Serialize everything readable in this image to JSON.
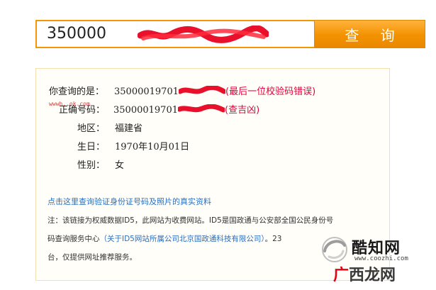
{
  "search": {
    "input_value": "350000",
    "button_label": "查 询"
  },
  "result": {
    "queried": {
      "label": "你查询的是：",
      "value": "35000019701",
      "note": "(最后一位校验码错误)"
    },
    "correct": {
      "label": "正确号码：",
      "value": "35000019701",
      "note": "(查吉凶)"
    },
    "region": {
      "label": "地区：",
      "value": "福建省"
    },
    "birthday": {
      "label": "生日：",
      "value": "1970年10月01日"
    },
    "gender": {
      "label": "性别：",
      "value": "女"
    }
  },
  "link": {
    "text": "点击这里查询验证身份证号码及照片的真实资料"
  },
  "notes": {
    "line1": "注：该链接为权威数据ID5，此网站为收费网站。ID5是国政通与公安部全国公民身份号",
    "line2_prefix": "码查询服务中心",
    "line2_link": "（关于ID5网站所属公司北京国政通科技有限公司）",
    "line2_suffix": "。23",
    "line3": "台，仅提供网址推荐服务。"
  },
  "watermark": {
    "small_text": "wwwh..ok.com",
    "logo_top": "酷知网",
    "logo_url": "www.coozhi.com",
    "logo_bottom_red": "广",
    "logo_bottom_rest": "西龙网"
  },
  "colors": {
    "accent": "#f39800",
    "note_red": "#e4003a",
    "link_blue": "#2a6fc0",
    "panel_border": "#f4dfae"
  }
}
